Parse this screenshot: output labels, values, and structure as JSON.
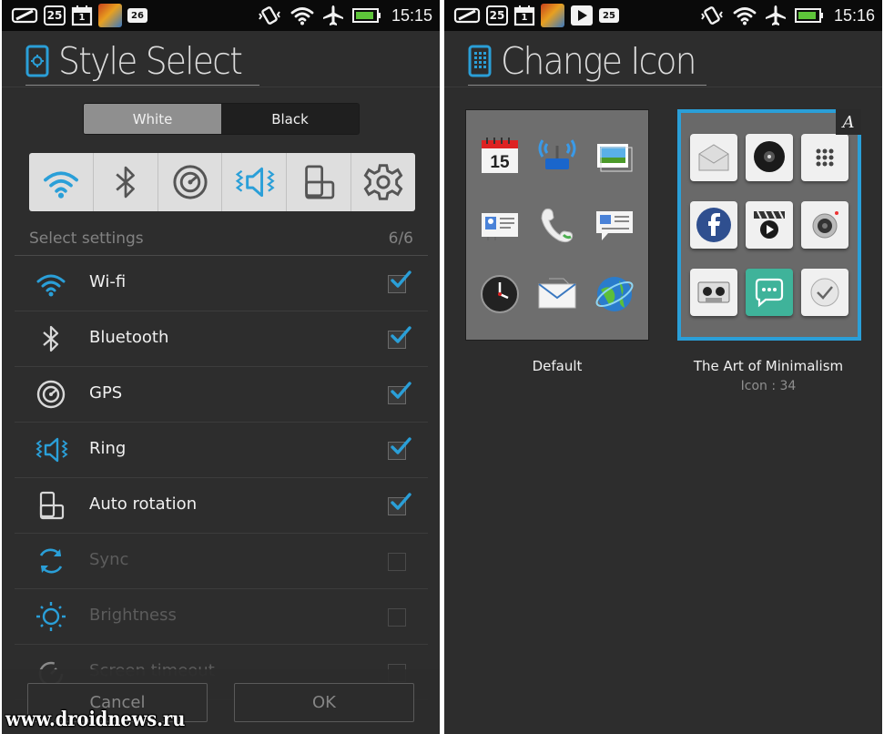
{
  "left_screen": {
    "status_bar": {
      "left_icons": [
        "screenshot-icon",
        "calendar-25-icon",
        "calendar-1-icon",
        "game-app-icon",
        "badge-26-icon"
      ],
      "calendar_day": "25",
      "calendar_small_day": "1",
      "badge": "26",
      "right_icons": [
        "vibrate-icon",
        "wifi-icon",
        "airplane-icon",
        "battery-icon"
      ],
      "time": "15:15"
    },
    "title": "Style Select",
    "style_options": [
      "White",
      "Black"
    ],
    "selected_style": "White",
    "toggle_icons": [
      "wifi-icon",
      "bluetooth-icon",
      "gps-icon",
      "ring-icon",
      "auto-rotation-icon",
      "settings-icon"
    ],
    "select_settings_label": "Select settings",
    "select_settings_count": "6/6",
    "settings": [
      {
        "label": "Wi-fi",
        "icon": "wifi-icon",
        "checked": true
      },
      {
        "label": "Bluetooth",
        "icon": "bluetooth-icon",
        "checked": true
      },
      {
        "label": "GPS",
        "icon": "gps-icon",
        "checked": true
      },
      {
        "label": "Ring",
        "icon": "ring-icon",
        "checked": true
      },
      {
        "label": "Auto rotation",
        "icon": "auto-rotation-icon",
        "checked": true
      },
      {
        "label": "Sync",
        "icon": "sync-icon",
        "checked": false
      },
      {
        "label": "Brightness",
        "icon": "brightness-icon",
        "checked": false
      },
      {
        "label": "Screen timeout",
        "icon": "screen-timeout-icon",
        "checked": false
      }
    ],
    "cancel_label": "Cancel",
    "ok_label": "OK"
  },
  "right_screen": {
    "status_bar": {
      "left_icons": [
        "screenshot-icon",
        "calendar-25-icon",
        "calendar-1-icon",
        "game-app-icon",
        "play-store-icon",
        "badge-25-icon"
      ],
      "calendar_day": "25",
      "calendar_small_day": "1",
      "badge": "25",
      "right_icons": [
        "vibrate-icon",
        "wifi-icon",
        "airplane-icon",
        "battery-icon"
      ],
      "time": "15:16"
    },
    "title": "Change Icon",
    "icon_packs": [
      {
        "name": "Default",
        "selected": false,
        "icons": [
          "calendar-icon",
          "wireless-icon",
          "gallery-icon",
          "contacts-icon",
          "phone-icon",
          "messaging-icon",
          "clock-icon",
          "email-icon",
          "browser-icon"
        ]
      },
      {
        "name": "The Art of Minimalism",
        "count": "Icon : 34",
        "selected": true,
        "badge": "A",
        "icons": [
          "email-icon",
          "music-icon",
          "dialer-icon",
          "facebook-icon",
          "video-icon",
          "camera-icon",
          "tape-icon",
          "chat-icon",
          "check-icon"
        ]
      }
    ]
  },
  "watermark": "www.droidnews.ru",
  "colors": {
    "accent": "#2a9fd8",
    "background": "#2d2d2d",
    "statusbar": "#0a0a0a"
  }
}
